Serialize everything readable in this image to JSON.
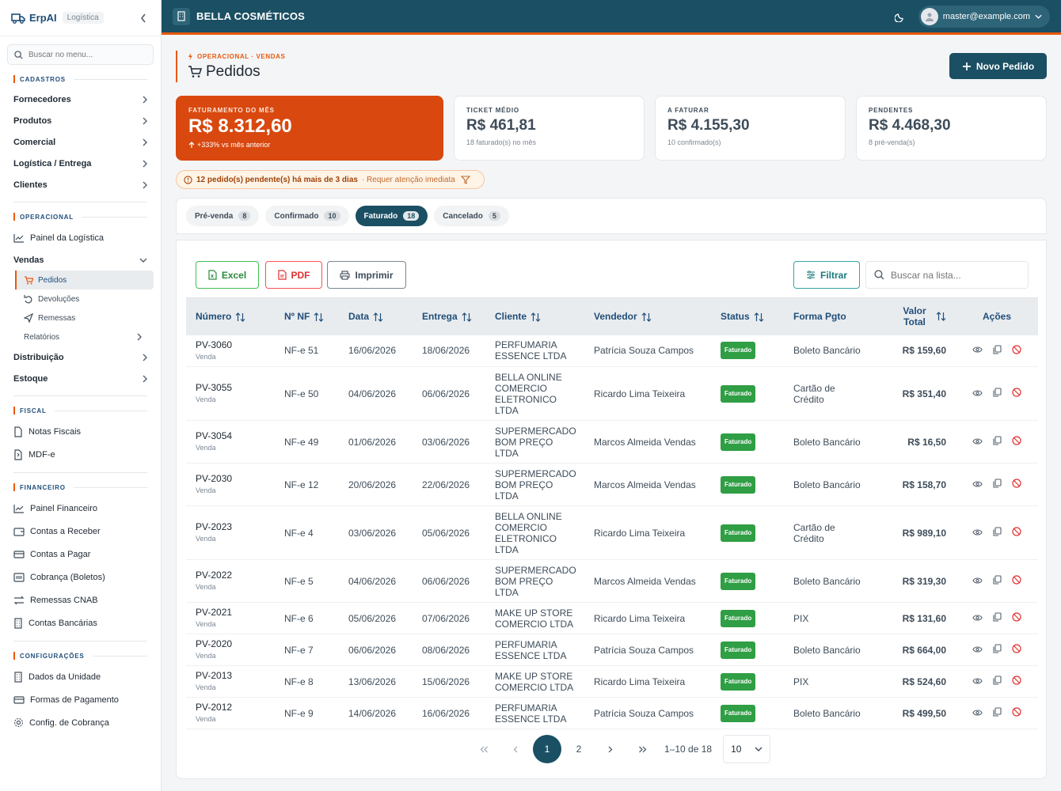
{
  "sidebar": {
    "brand": "ErpAI",
    "brand_tag": "Logística",
    "search_placeholder": "Buscar no menu...",
    "sections": {
      "cadastros": "CADASTROS",
      "operacional": "OPERACIONAL",
      "fiscal": "FISCAL",
      "financeiro": "FINANCEIRO",
      "configuracoes": "CONFIGURAÇÕES"
    },
    "cadastros_items": [
      "Fornecedores",
      "Produtos",
      "Comercial",
      "Logística / Entrega",
      "Clientes"
    ],
    "painel_logistica": "Painel da Logística",
    "vendas": "Vendas",
    "vendas_sub": [
      "Pedidos",
      "Devoluções",
      "Remessas",
      "Relatórios"
    ],
    "distribuicao": "Distribuição",
    "estoque": "Estoque",
    "fiscal_items": [
      "Notas Fiscais",
      "MDF-e"
    ],
    "financeiro_items": [
      "Painel Financeiro",
      "Contas a Receber",
      "Contas a Pagar",
      "Cobrança (Boletos)",
      "Remessas CNAB",
      "Contas Bancárias"
    ],
    "config_items": [
      "Dados da Unidade",
      "Formas de Pagamento",
      "Config. de Cobrança"
    ]
  },
  "header": {
    "company": "BELLA COSMÉTICOS",
    "user_email": "master@example.com"
  },
  "page": {
    "breadcrumb": "OPERACIONAL · VENDAS",
    "title": "Pedidos",
    "new_button": "Novo Pedido"
  },
  "kpis": [
    {
      "label": "FATURAMENTO DO MÊS",
      "value": "R$ 8.312,60",
      "sub": "+333% vs mês anterior"
    },
    {
      "label": "TICKET MÉDIO",
      "value": "R$ 461,81",
      "sub": "18 faturado(s) no mês"
    },
    {
      "label": "A FATURAR",
      "value": "R$ 4.155,30",
      "sub": "10 confirmado(s)"
    },
    {
      "label": "PENDENTES",
      "value": "R$ 4.468,30",
      "sub": "8 pré-venda(s)"
    }
  ],
  "alert": {
    "strong": "12 pedido(s) pendente(s) há mais de 3 dias",
    "muted": "· Requer atenção imediata"
  },
  "tabs": [
    {
      "label": "Pré-venda",
      "count": "8"
    },
    {
      "label": "Confirmado",
      "count": "10"
    },
    {
      "label": "Faturado",
      "count": "18"
    },
    {
      "label": "Cancelado",
      "count": "5"
    }
  ],
  "toolbar": {
    "excel": "Excel",
    "pdf": "PDF",
    "print": "Imprimir",
    "filter": "Filtrar",
    "search_placeholder": "Buscar na lista..."
  },
  "table": {
    "headers": {
      "numero": "Número",
      "nf": "Nº NF",
      "data": "Data",
      "entrega": "Entrega",
      "cliente": "Cliente",
      "vendedor": "Vendedor",
      "status": "Status",
      "forma": "Forma Pgto",
      "valor": "Valor Total",
      "acoes": "Ações"
    },
    "rows": [
      {
        "numero": "PV-3060",
        "tipo": "Venda",
        "nf": "NF-e 51",
        "data": "16/06/2026",
        "entrega": "18/06/2026",
        "cliente": "PERFUMARIA ESSENCE LTDA",
        "vendedor": "Patrícia Souza Campos",
        "status": "Faturado",
        "forma": "Boleto Bancário",
        "valor": "R$ 159,60"
      },
      {
        "numero": "PV-3055",
        "tipo": "Venda",
        "nf": "NF-e 50",
        "data": "04/06/2026",
        "entrega": "06/06/2026",
        "cliente": "BELLA ONLINE COMERCIO ELETRONICO LTDA",
        "vendedor": "Ricardo Lima Teixeira",
        "status": "Faturado",
        "forma": "Cartão de Crédito",
        "valor": "R$ 351,40"
      },
      {
        "numero": "PV-3054",
        "tipo": "Venda",
        "nf": "NF-e 49",
        "data": "01/06/2026",
        "entrega": "03/06/2026",
        "cliente": "SUPERMERCADO BOM PREÇO LTDA",
        "vendedor": "Marcos Almeida Vendas",
        "status": "Faturado",
        "forma": "Boleto Bancário",
        "valor": "R$ 16,50"
      },
      {
        "numero": "PV-2030",
        "tipo": "Venda",
        "nf": "NF-e 12",
        "data": "20/06/2026",
        "entrega": "22/06/2026",
        "cliente": "SUPERMERCADO BOM PREÇO LTDA",
        "vendedor": "Marcos Almeida Vendas",
        "status": "Faturado",
        "forma": "Boleto Bancário",
        "valor": "R$ 158,70"
      },
      {
        "numero": "PV-2023",
        "tipo": "Venda",
        "nf": "NF-e 4",
        "data": "03/06/2026",
        "entrega": "05/06/2026",
        "cliente": "BELLA ONLINE COMERCIO ELETRONICO LTDA",
        "vendedor": "Ricardo Lima Teixeira",
        "status": "Faturado",
        "forma": "Cartão de Crédito",
        "valor": "R$ 989,10"
      },
      {
        "numero": "PV-2022",
        "tipo": "Venda",
        "nf": "NF-e 5",
        "data": "04/06/2026",
        "entrega": "06/06/2026",
        "cliente": "SUPERMERCADO BOM PREÇO LTDA",
        "vendedor": "Marcos Almeida Vendas",
        "status": "Faturado",
        "forma": "Boleto Bancário",
        "valor": "R$ 319,30"
      },
      {
        "numero": "PV-2021",
        "tipo": "Venda",
        "nf": "NF-e 6",
        "data": "05/06/2026",
        "entrega": "07/06/2026",
        "cliente": "MAKE UP STORE COMERCIO LTDA",
        "vendedor": "Ricardo Lima Teixeira",
        "status": "Faturado",
        "forma": "PIX",
        "valor": "R$ 131,60"
      },
      {
        "numero": "PV-2020",
        "tipo": "Venda",
        "nf": "NF-e 7",
        "data": "06/06/2026",
        "entrega": "08/06/2026",
        "cliente": "PERFUMARIA ESSENCE LTDA",
        "vendedor": "Patrícia Souza Campos",
        "status": "Faturado",
        "forma": "Boleto Bancário",
        "valor": "R$ 664,00"
      },
      {
        "numero": "PV-2013",
        "tipo": "Venda",
        "nf": "NF-e 8",
        "data": "13/06/2026",
        "entrega": "15/06/2026",
        "cliente": "MAKE UP STORE COMERCIO LTDA",
        "vendedor": "Ricardo Lima Teixeira",
        "status": "Faturado",
        "forma": "PIX",
        "valor": "R$ 524,60"
      },
      {
        "numero": "PV-2012",
        "tipo": "Venda",
        "nf": "NF-e 9",
        "data": "14/06/2026",
        "entrega": "16/06/2026",
        "cliente": "PERFUMARIA ESSENCE LTDA",
        "vendedor": "Patrícia Souza Campos",
        "status": "Faturado",
        "forma": "Boleto Bancário",
        "valor": "R$ 499,50"
      }
    ]
  },
  "pagination": {
    "pages": [
      "1",
      "2"
    ],
    "range": "1–10 de 18",
    "page_size": "10"
  },
  "colors": {
    "brand": "#1b4f63",
    "accent": "#e8590c",
    "status_faturado": "#2f9e44"
  }
}
